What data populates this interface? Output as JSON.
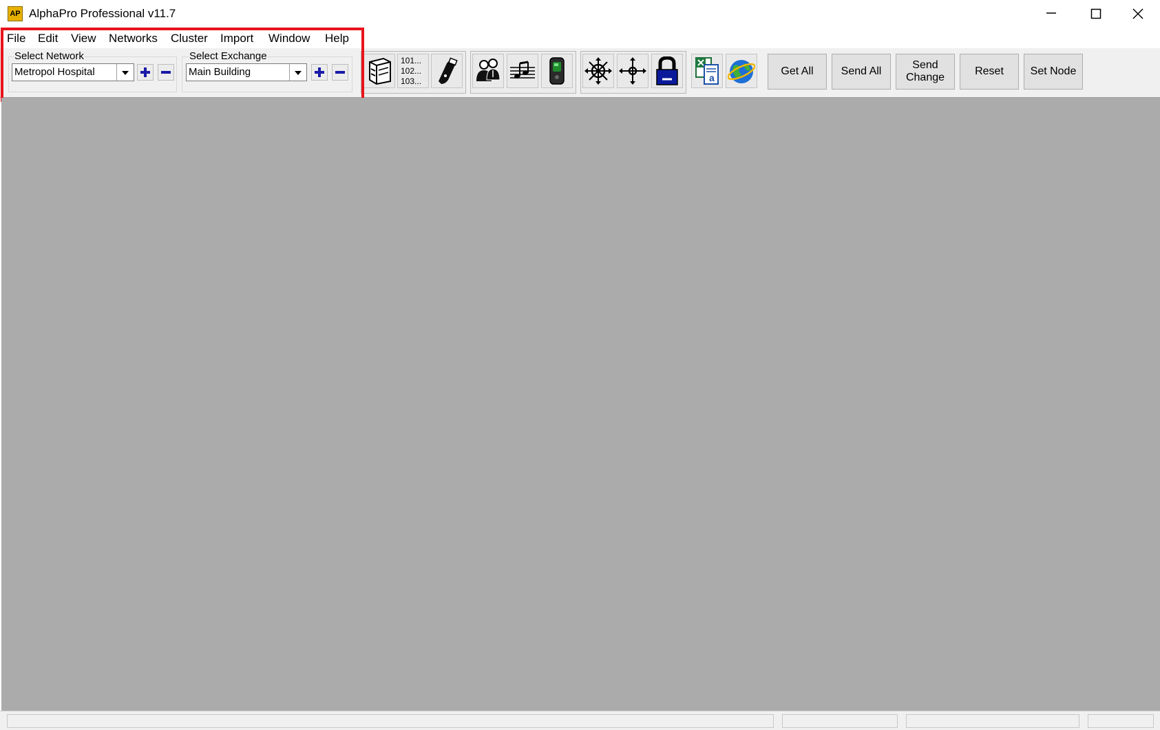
{
  "window": {
    "title": "AlphaPro Professional v11.7",
    "app_icon_text": "AP",
    "controls": [
      "minimize",
      "maximize",
      "close"
    ]
  },
  "menu": {
    "items": [
      "File",
      "Edit",
      "View",
      "Networks",
      "Cluster",
      "Import",
      "Window",
      "Help"
    ]
  },
  "toolbar": {
    "network": {
      "label": "Select Network",
      "value": "Metropol Hospital"
    },
    "exchange": {
      "label": "Select Exchange",
      "value": "Main Building"
    },
    "number_list": [
      "101...",
      "102...",
      "103..."
    ],
    "icon_names": [
      "exchange-cabinet-icon",
      "number-list-icon",
      "handset-icon",
      "users-group-icon",
      "music-on-hold-icon",
      "door-station-icon",
      "network-expand-icon",
      "network-node-icon",
      "padlock-icon",
      "excel-export-icon",
      "internet-globe-icon"
    ],
    "buttons": {
      "get_all": "Get All",
      "send_all": "Send All",
      "send_change_line1": "Send",
      "send_change_line2": "Change",
      "reset": "Reset",
      "set_node": "Set Node"
    }
  },
  "colors": {
    "highlight": "#e8131b",
    "workspace": "#ababab",
    "accent_blue": "#1a1aa8"
  }
}
